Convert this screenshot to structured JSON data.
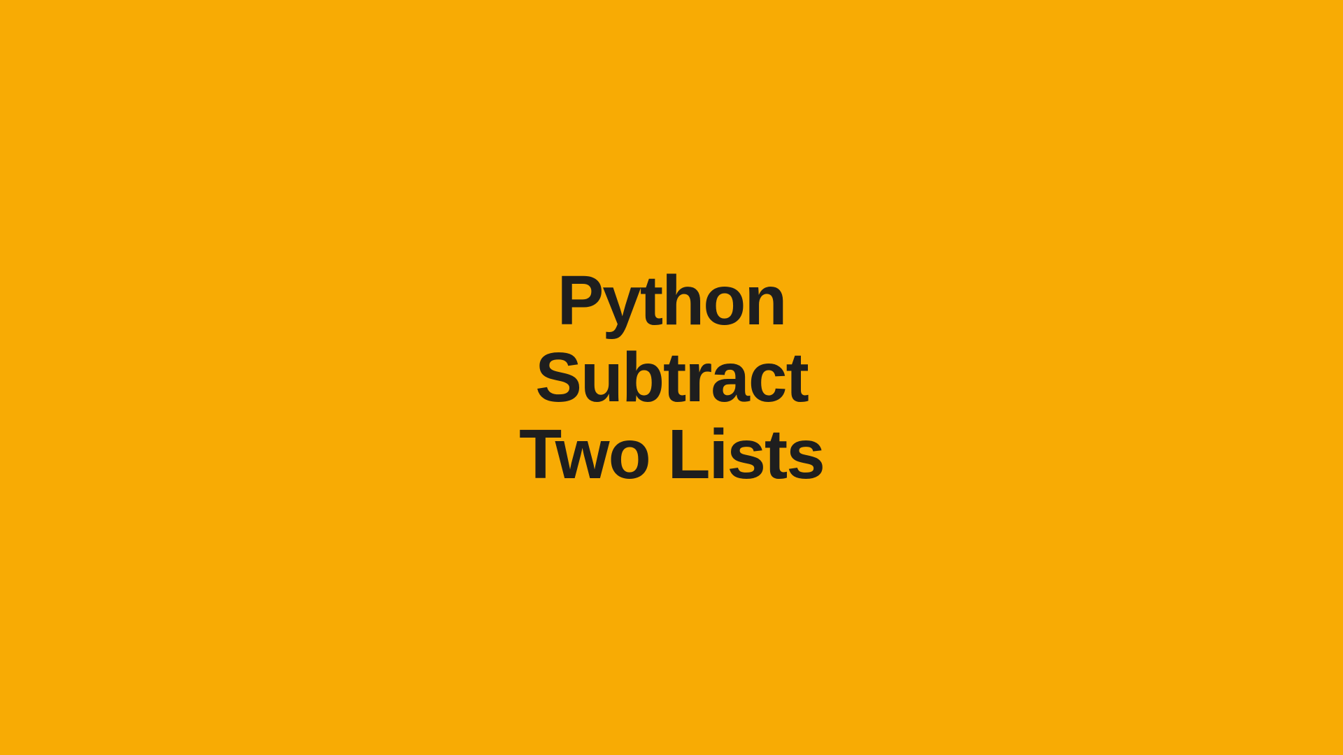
{
  "colors": {
    "background": "#F8AB04",
    "text": "#1e1e1e"
  },
  "title": {
    "line1": "Python",
    "line2": "Subtract",
    "line3": "Two Lists"
  }
}
